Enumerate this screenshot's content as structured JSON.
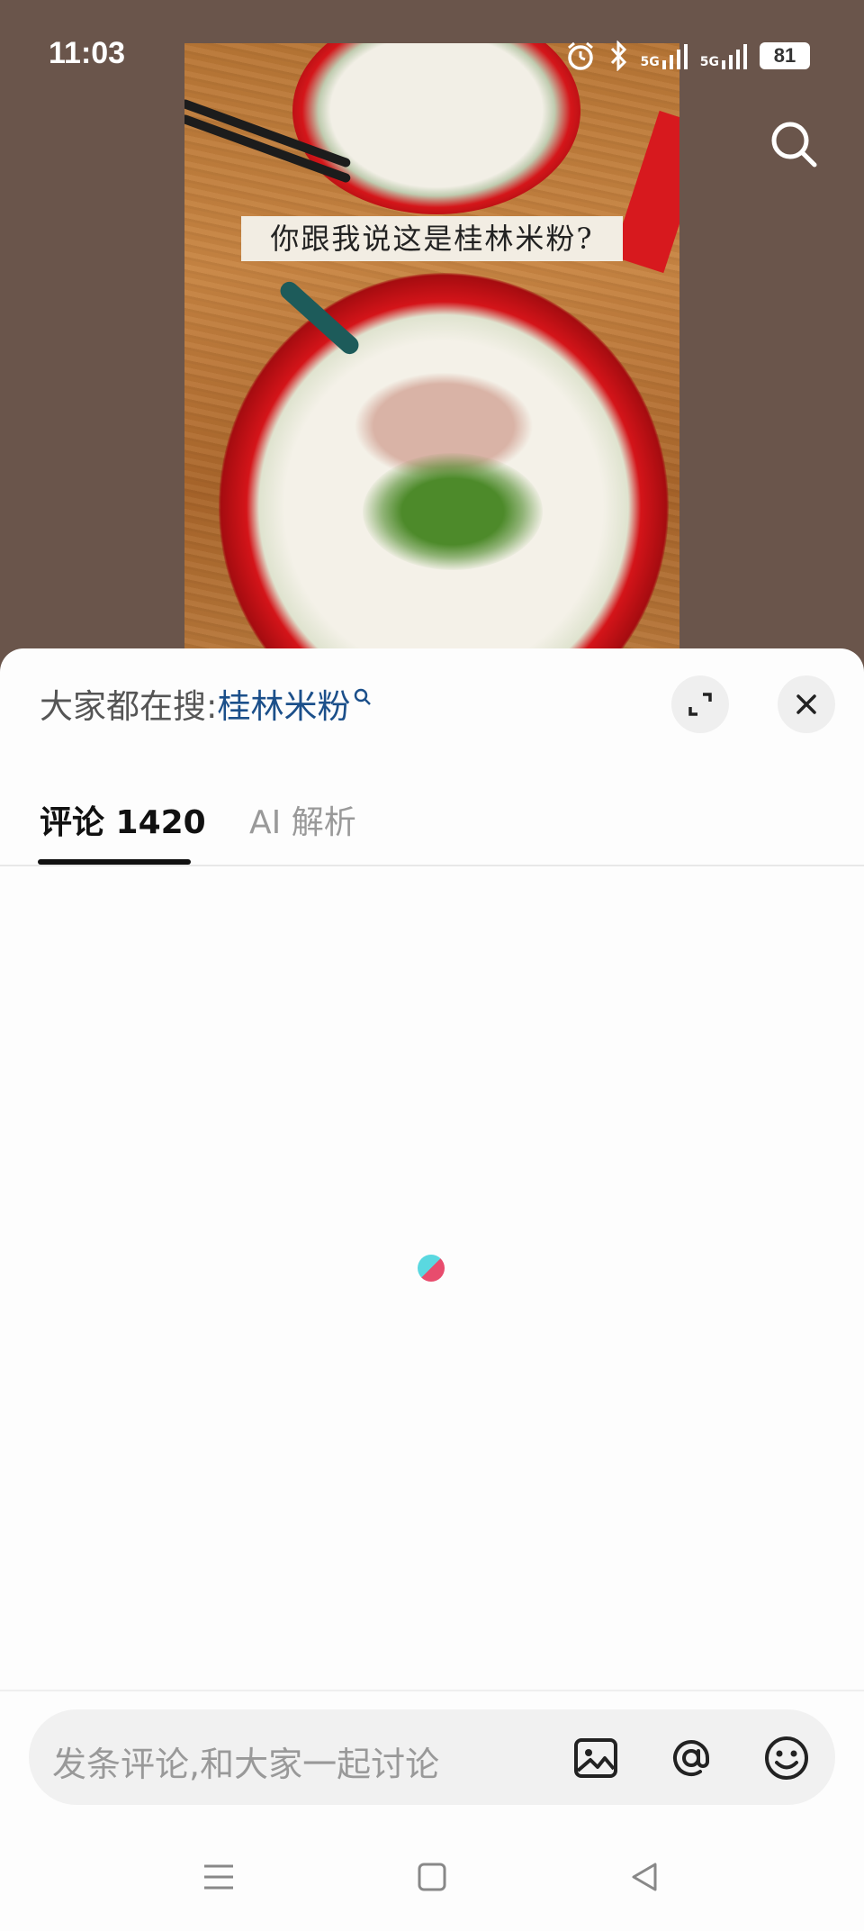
{
  "status_bar": {
    "time": "11:03",
    "network1": "5G",
    "network2": "5G",
    "battery": "81"
  },
  "video": {
    "caption": "你跟我说这是桂林米粉?"
  },
  "sheet": {
    "search_prefix": "大家都在搜:",
    "search_keyword": "桂林米粉",
    "tabs": [
      {
        "label": "评论 1420",
        "active": true
      },
      {
        "label": "AI 解析",
        "active": false
      }
    ]
  },
  "input": {
    "placeholder": "发条评论,和大家一起讨论"
  },
  "icons": {
    "top_search": "search-icon",
    "expand": "expand-icon",
    "close": "close-icon",
    "image": "image-icon",
    "mention": "at-icon",
    "emoji": "emoji-icon",
    "loading": "loading-spinner"
  },
  "colors": {
    "keyword": "#1b4f8a",
    "tab_active": "#111111",
    "tab_inactive": "#999999",
    "background_video": "#6a554b"
  }
}
